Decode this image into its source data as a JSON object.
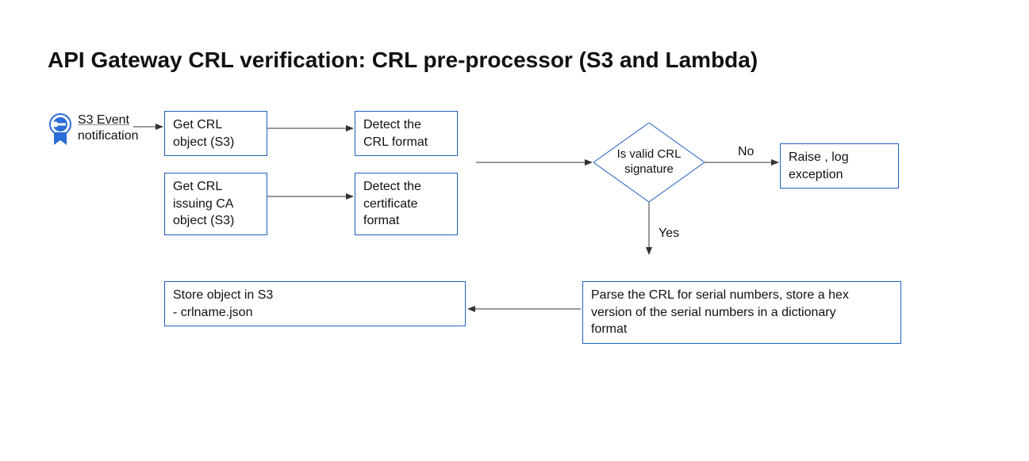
{
  "title": "API Gateway CRL verification: CRL pre-processor (S3 and Lambda)",
  "event": {
    "line1": "S3 Event",
    "line2": "notification"
  },
  "boxes": {
    "getCrl": "Get CRL\nobject (S3)",
    "getCa": "Get CRL\nissuing CA\nobject (S3)",
    "detectCrl": "Detect the\nCRL format",
    "detectCert": "Detect the\ncertificate\nformat",
    "raise": "Raise , log\nexception",
    "parse": "Parse the CRL for serial numbers, store a hex\nversion of the serial numbers in a dictionary\nformat",
    "store": "Store object in S3\n-   crlname.json"
  },
  "diamond": "Is valid CRL\nsignature",
  "labels": {
    "no": "No",
    "yes": "Yes"
  }
}
